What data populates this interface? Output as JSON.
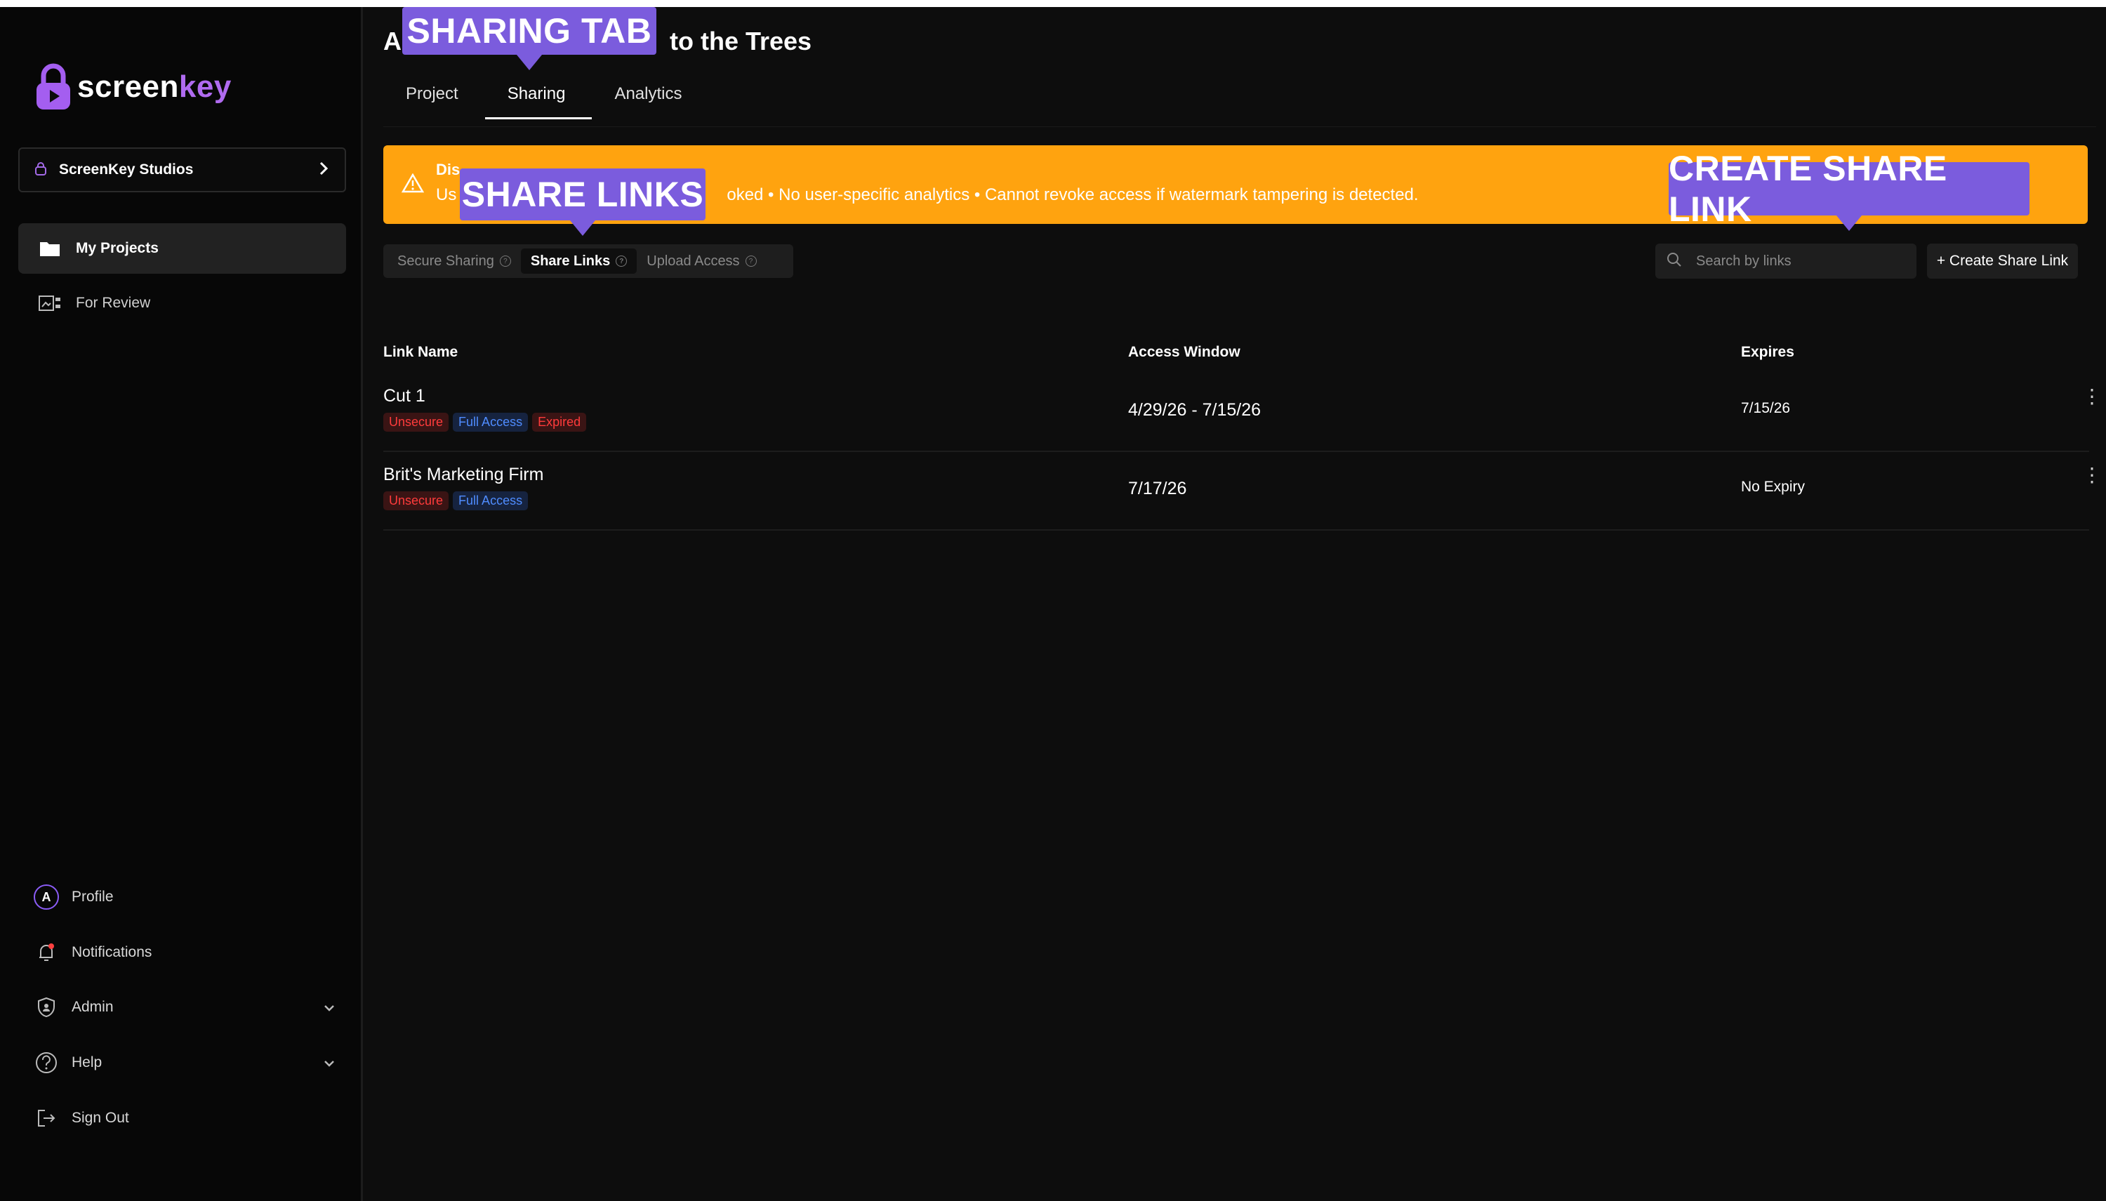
{
  "brand": {
    "word1": "screen",
    "word2": "key"
  },
  "workspace": {
    "name": "ScreenKey Studios"
  },
  "sidebar": {
    "items": [
      {
        "label": "My Projects",
        "icon": "folder-icon"
      },
      {
        "label": "For Review",
        "icon": "review-icon"
      }
    ],
    "bottom": [
      {
        "label": "Profile",
        "icon": "avatar-icon",
        "avatar_letter": "A"
      },
      {
        "label": "Notifications",
        "icon": "bell-icon"
      },
      {
        "label": "Admin",
        "icon": "shield-icon"
      },
      {
        "label": "Help",
        "icon": "help-icon"
      },
      {
        "label": "Sign Out",
        "icon": "sign-out-icon"
      }
    ]
  },
  "page": {
    "title_left": "A",
    "title_right": "to the Trees",
    "tabs": [
      {
        "label": "Project"
      },
      {
        "label": "Sharing",
        "active": true
      },
      {
        "label": "Analytics"
      }
    ]
  },
  "banner": {
    "title": "Dis",
    "text_left": "Us",
    "text_right": "oked • No user-specific analytics • Cannot revoke access if watermark tampering is detected.",
    "color": "#ffa30f"
  },
  "segments": [
    {
      "label": "Secure Sharing"
    },
    {
      "label": "Share Links",
      "active": true
    },
    {
      "label": "Upload Access"
    }
  ],
  "search": {
    "placeholder": "Search by links"
  },
  "create_button": {
    "label": "+ Create Share Link"
  },
  "table": {
    "headers": {
      "name": "Link Name",
      "window": "Access Window",
      "expires": "Expires"
    },
    "rows": [
      {
        "name": "Cut 1",
        "badges": [
          "Unsecure",
          "Full Access",
          "Expired"
        ],
        "window": "4/29/26 - 7/15/26",
        "expires": "7/15/26"
      },
      {
        "name": "Brit's Marketing Firm",
        "badges": [
          "Unsecure",
          "Full Access"
        ],
        "window": "7/17/26",
        "expires": "No Expiry"
      }
    ]
  },
  "callouts": {
    "sharing_tab": "SHARING TAB",
    "share_links": "SHARE LINKS",
    "create_share_link": "CREATE SHARE LINK",
    "color": "#7b5cdd"
  }
}
